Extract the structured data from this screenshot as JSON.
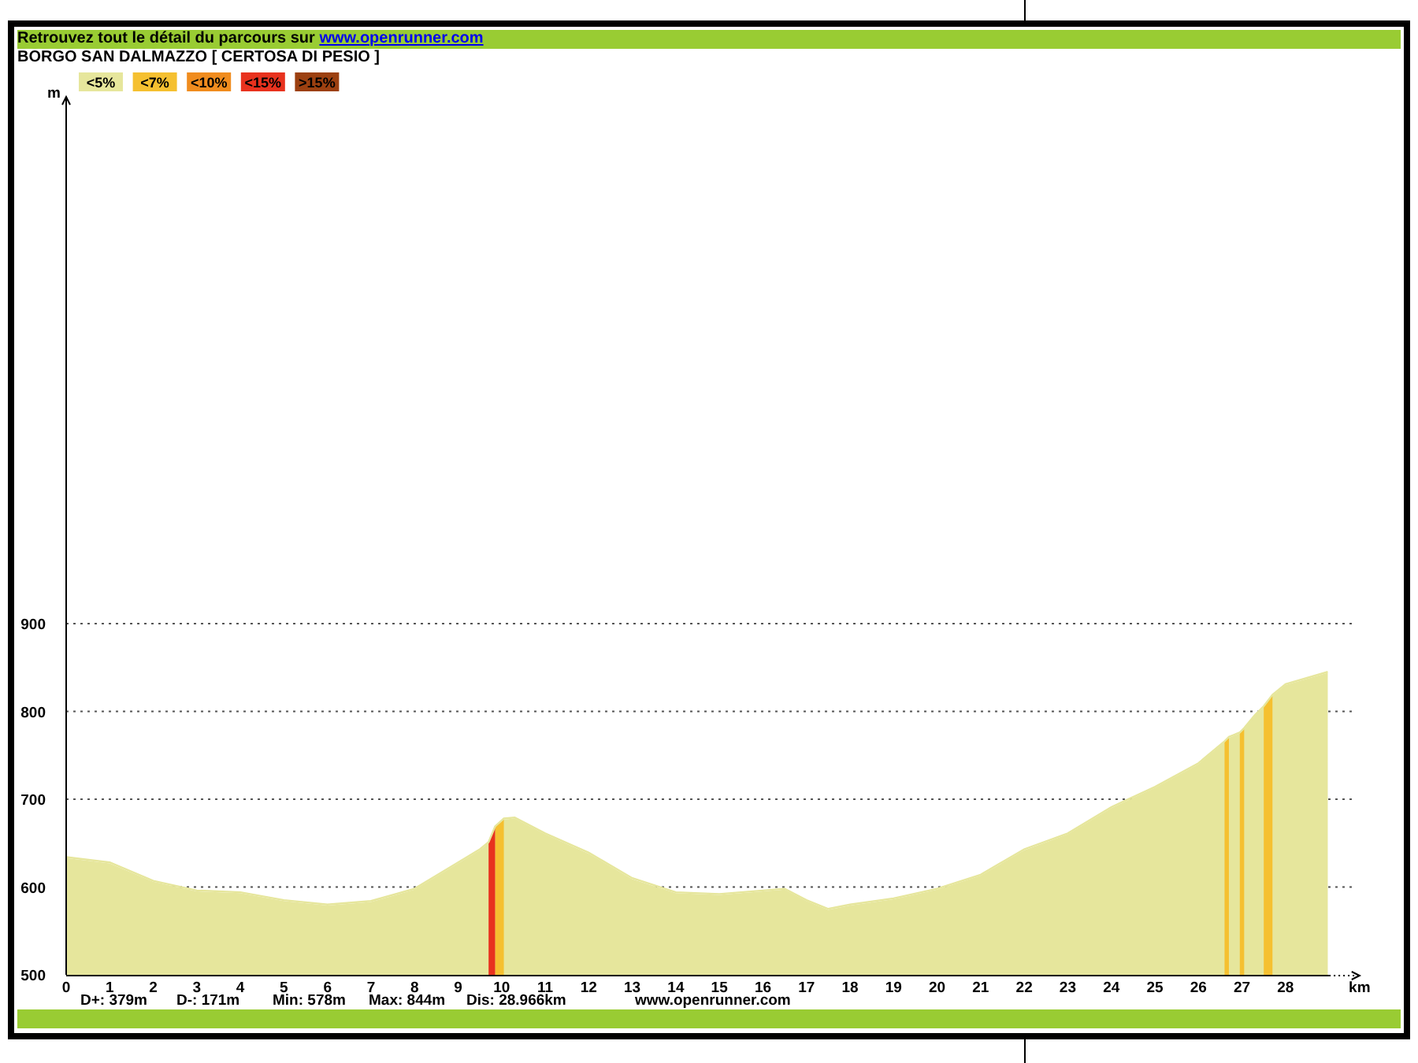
{
  "header": {
    "text": "Retrouvez tout le détail du parcours sur ",
    "link": "www.openrunner.com"
  },
  "title": "BORGO SAN DALMAZZO [ CERTOSA DI PESIO ]",
  "legend": [
    {
      "label": "<5%",
      "color": "#e6e69c"
    },
    {
      "label": "<7%",
      "color": "#f5c030"
    },
    {
      "label": "<10%",
      "color": "#f08c1e"
    },
    {
      "label": "<15%",
      "color": "#e8321e"
    },
    {
      "label": ">15%",
      "color": "#9c4010"
    }
  ],
  "chart_data": {
    "type": "area",
    "xlabel": "km",
    "ylabel": "m",
    "xlim": [
      0,
      29.7
    ],
    "ylim": [
      500,
      1500
    ],
    "grid": true,
    "xticks": [
      0,
      1,
      2,
      3,
      4,
      5,
      6,
      7,
      8,
      9,
      10,
      11,
      12,
      13,
      14,
      15,
      16,
      17,
      18,
      19,
      20,
      21,
      22,
      23,
      24,
      25,
      26,
      27,
      28
    ],
    "yticks": [
      500,
      600,
      700,
      800,
      900
    ],
    "x": [
      0,
      1,
      2,
      3,
      4,
      5,
      6,
      7,
      8,
      9,
      9.5,
      9.7,
      9.85,
      10.05,
      10.3,
      11,
      12,
      13,
      14,
      15,
      16,
      16.5,
      17,
      17.5,
      18,
      19,
      20,
      21,
      22,
      23,
      24,
      25,
      26,
      26.6,
      26.7,
      26.8,
      26.95,
      27.05,
      27.3,
      27.5,
      27.7,
      28,
      28.97
    ],
    "series": [
      {
        "color": "#e6e69c",
        "values": [
          633,
          627,
          606,
          595,
          593,
          584,
          579,
          583,
          597,
          627,
          642,
          650,
          668,
          677,
          678,
          660,
          638,
          609,
          593,
          591,
          595,
          597,
          584,
          574,
          579,
          586,
          597,
          613,
          642,
          660,
          690,
          713,
          740,
          765,
          770,
          772,
          775,
          780,
          795,
          805,
          818,
          830,
          844
        ]
      },
      {
        "color": "#f5c030",
        "values": [
          null,
          null,
          null,
          null,
          null,
          null,
          null,
          null,
          null,
          null,
          null,
          null,
          668,
          677,
          null,
          null,
          null,
          null,
          null,
          null,
          null,
          null,
          null,
          null,
          null,
          null,
          null,
          null,
          null,
          null,
          null,
          null,
          null,
          765,
          770,
          null,
          775,
          780,
          null,
          805,
          818,
          null,
          null
        ]
      },
      {
        "color": "#e8321e",
        "values": [
          null,
          null,
          null,
          null,
          null,
          null,
          null,
          null,
          null,
          null,
          null,
          650,
          668,
          null,
          null,
          null,
          null,
          null,
          null,
          null,
          null,
          null,
          null,
          null,
          null,
          null,
          null,
          null,
          null,
          null,
          null,
          null,
          null,
          null,
          null,
          null,
          null,
          null,
          null,
          null,
          null,
          null,
          null
        ]
      }
    ]
  },
  "stats": [
    "D+: 379m",
    "D-: 171m",
    "Min: 578m",
    "Max: 844m",
    "Dis: 28.966km"
  ],
  "footer_link": "www.openrunner.com"
}
